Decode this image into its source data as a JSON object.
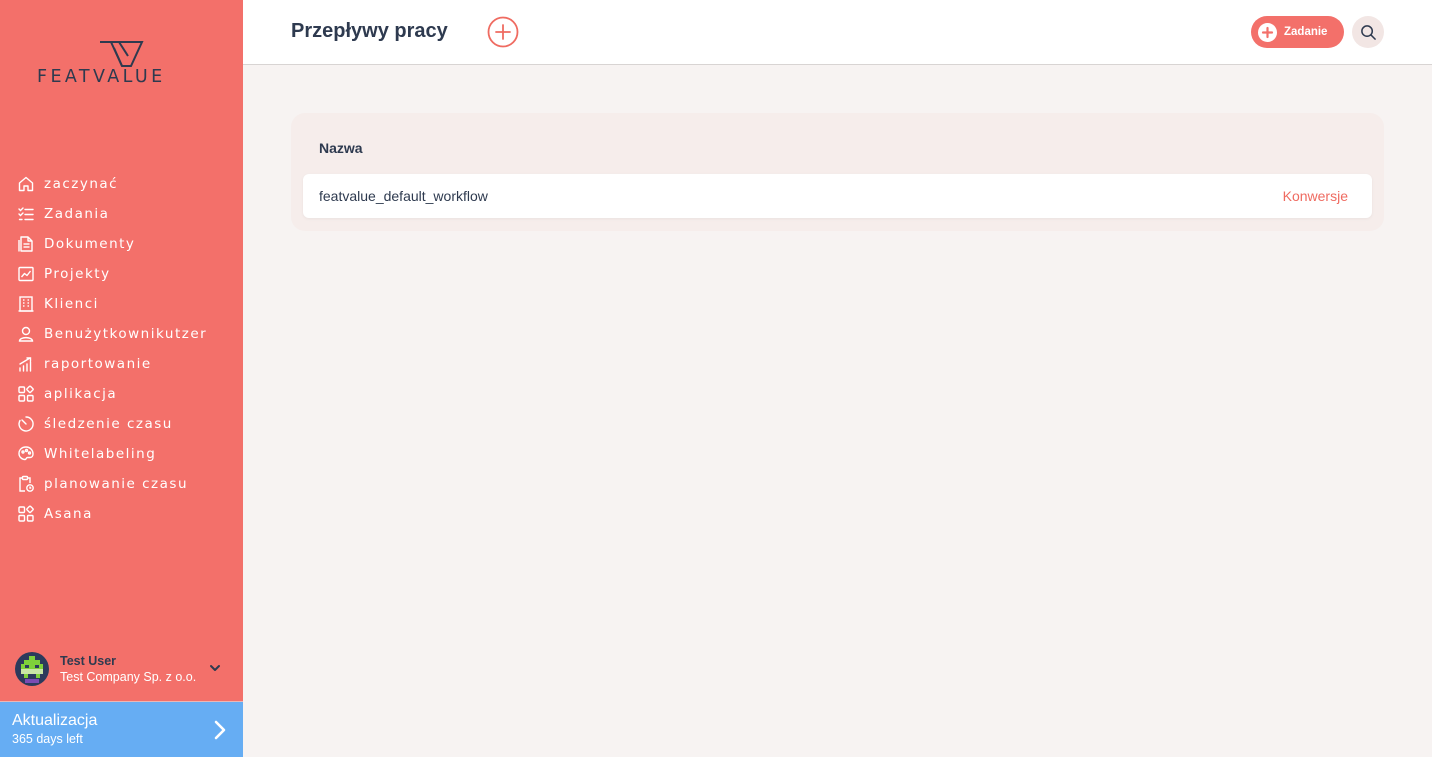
{
  "brand": {
    "name": "FEATVALUE"
  },
  "sidebar": {
    "items": [
      {
        "label": "zaczynać",
        "icon": "home-icon"
      },
      {
        "label": "Zadania",
        "icon": "checklist-icon"
      },
      {
        "label": "Dokumenty",
        "icon": "document-icon"
      },
      {
        "label": "Projekty",
        "icon": "chart-board-icon"
      },
      {
        "label": "Klienci",
        "icon": "building-icon"
      },
      {
        "label": "Benużytkownikutzer",
        "icon": "user-icon"
      },
      {
        "label": "raportowanie",
        "icon": "reporting-icon"
      },
      {
        "label": "aplikacja",
        "icon": "apps-icon"
      },
      {
        "label": "śledzenie czasu",
        "icon": "timer-icon"
      },
      {
        "label": "Whitelabeling",
        "icon": "palette-icon"
      },
      {
        "label": "planowanie czasu",
        "icon": "clipboard-clock-icon"
      },
      {
        "label": "Asana",
        "icon": "apps-icon"
      }
    ],
    "user": {
      "name": "Test User",
      "company": "Test Company Sp. z o.o."
    },
    "upgrade": {
      "title": "Aktualizacja",
      "subtitle": "365 days left"
    }
  },
  "header": {
    "title": "Przepływy pracy",
    "task_button_label": "Zadanie"
  },
  "table": {
    "column_header": "Nazwa",
    "rows": [
      {
        "name": "featvalue_default_workflow",
        "action": "Konwersje"
      }
    ]
  },
  "colors": {
    "sidebar": "#f3706a",
    "accent": "#ef6b61",
    "upgrade": "#66adf3",
    "text_dark": "#2e3a4f",
    "background": "#f7f3f2"
  }
}
